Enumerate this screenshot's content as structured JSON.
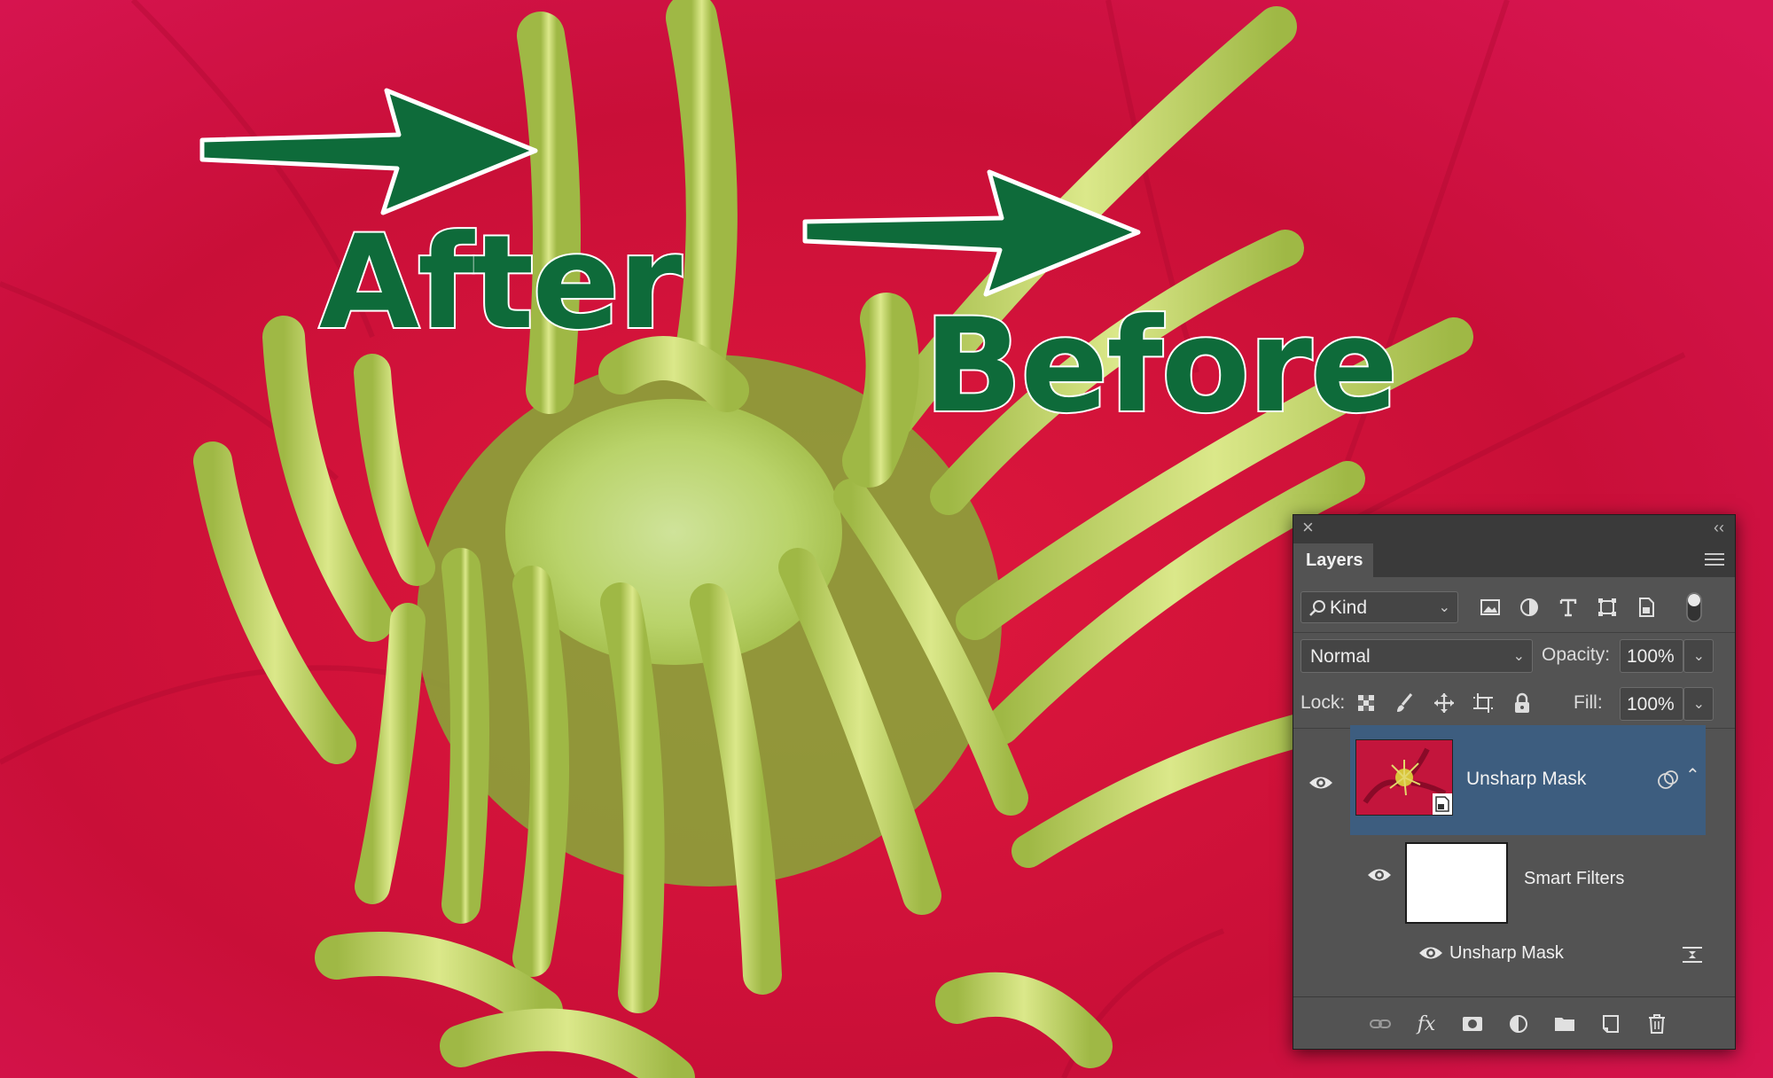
{
  "annotations": {
    "after_label": "After",
    "before_label": "Before",
    "color": "#0e6b3a"
  },
  "layers_panel": {
    "tab_label": "Layers",
    "filter": {
      "kind_label": "Kind",
      "icons": [
        "image-filter-icon",
        "adjustment-filter-icon",
        "type-filter-icon",
        "shape-filter-icon",
        "smart-object-filter-icon",
        "filter-toggle-icon"
      ]
    },
    "blend_mode": "Normal",
    "opacity_label": "Opacity:",
    "opacity_value": "100%",
    "lock_label": "Lock:",
    "fill_label": "Fill:",
    "fill_value": "100%",
    "layers": [
      {
        "name": "Unsharp Mask",
        "selected": true,
        "type": "smart-object"
      }
    ],
    "smart_filters_label": "Smart Filters",
    "filter_items": [
      {
        "name": "Unsharp Mask"
      }
    ],
    "footer_icons": [
      "link-icon",
      "fx-icon",
      "mask-icon",
      "adjustment-icon",
      "folder-icon",
      "new-layer-icon",
      "trash-icon"
    ]
  },
  "colors": {
    "petal": "#c80f3a",
    "stamen": "#c7dc6a",
    "selection": "#3d5d7f",
    "panel_bg": "#535353"
  }
}
